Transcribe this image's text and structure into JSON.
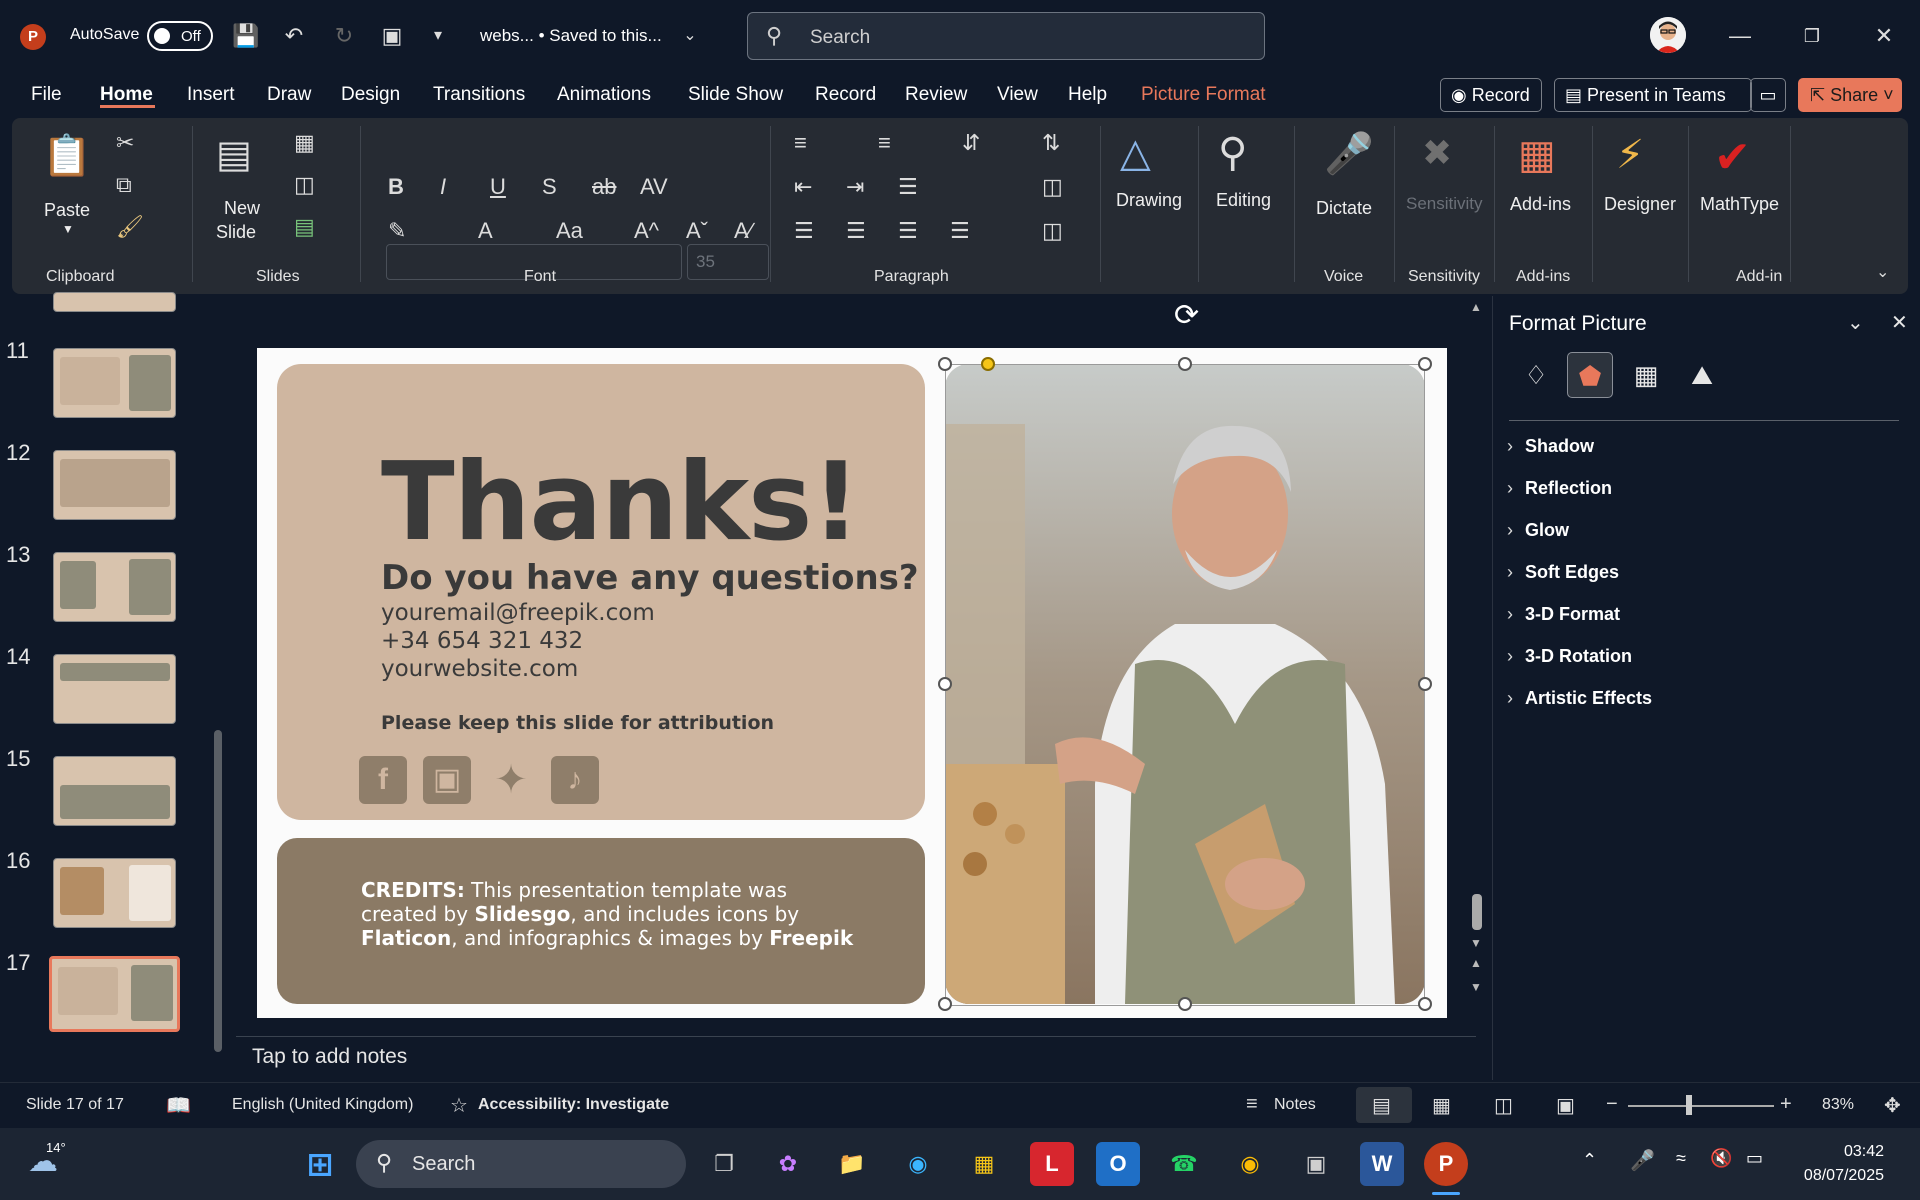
{
  "titlebar": {
    "autosave_label": "AutoSave",
    "autosave_state": "Off",
    "doc_title": "webs... • Saved to this...",
    "search_placeholder": "Search"
  },
  "menu": {
    "items": [
      "File",
      "Home",
      "Insert",
      "Draw",
      "Design",
      "Transitions",
      "Animations",
      "Slide Show",
      "Record",
      "Review",
      "View",
      "Help",
      "Picture Format"
    ],
    "record_btn": "Record",
    "present_btn": "Present in Teams",
    "share_btn": "Share"
  },
  "ribbon": {
    "paste": "Paste",
    "new_slide_1": "New",
    "new_slide_2": "Slide",
    "font_size": "35",
    "drawing": "Drawing",
    "editing": "Editing",
    "dictate": "Dictate",
    "sensitivity": "Sensitivity",
    "addins": "Add-ins",
    "designer": "Designer",
    "mathtype": "MathType",
    "groups": {
      "clipboard": "Clipboard",
      "slides": "Slides",
      "font": "Font",
      "paragraph": "Paragraph",
      "voice": "Voice",
      "sensitivity": "Sensitivity",
      "addins": "Add-ins",
      "addin": "Add-in"
    }
  },
  "thumbnails": [
    "11",
    "12",
    "13",
    "14",
    "15",
    "16",
    "17"
  ],
  "slide": {
    "title": "Thanks!",
    "question": "Do you have any questions?",
    "email": "youremail@freepik.com",
    "phone": "+34 654 321 432",
    "website": "yourwebsite.com",
    "keep": "Please keep this slide for attribution",
    "credits_label": "CREDITS:",
    "credits_1": " This presentation template was created by ",
    "credits_slidesgo": "Slidesgo",
    "credits_2": ", and includes icons by ",
    "credits_flaticon": "Flaticon",
    "credits_3": ", and infographics & images by ",
    "credits_freepik": "Freepik"
  },
  "notes_placeholder": "Tap to add notes",
  "pane": {
    "title": "Format Picture",
    "sections": [
      "Shadow",
      "Reflection",
      "Glow",
      "Soft Edges",
      "3-D Format",
      "3-D Rotation",
      "Artistic Effects"
    ]
  },
  "status": {
    "slide_count": "Slide 17 of 17",
    "language": "English (United Kingdom)",
    "accessibility": "Accessibility: Investigate",
    "notes": "Notes",
    "zoom": "83%"
  },
  "taskbar": {
    "weather": "14°",
    "search": "Search",
    "time": "03:42",
    "date": "08/07/2025"
  },
  "colors": {
    "accent": "#e8785b",
    "slide_card": "#cfb6a0",
    "slide_card_dark": "#8b7a65"
  }
}
